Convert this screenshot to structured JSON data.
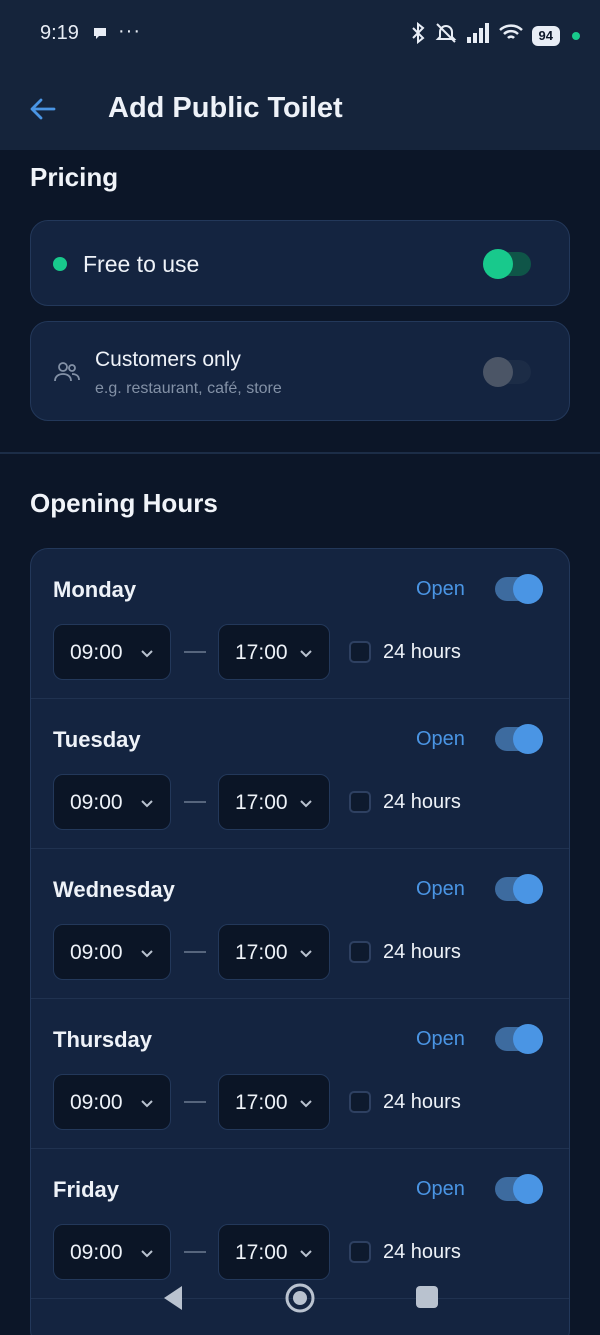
{
  "status_bar": {
    "time": "9:19",
    "dots": "···",
    "battery": "94"
  },
  "app_bar": {
    "title": "Add Public Toilet",
    "back_icon": "arrow-left-icon"
  },
  "pricing": {
    "title": "Pricing",
    "free": {
      "label": "Free to use",
      "enabled": true
    },
    "customers": {
      "label": "Customers only",
      "hint": "e.g. restaurant, café, store",
      "enabled": false,
      "icon": "people-icon"
    }
  },
  "opening_hours": {
    "title": "Opening Hours",
    "days": [
      {
        "name": "Monday",
        "status": "Open",
        "start": "09:00",
        "end": "17:00",
        "all_day_label": "24 hours"
      },
      {
        "name": "Tuesday",
        "status": "Open",
        "start": "09:00",
        "end": "17:00",
        "all_day_label": "24 hours"
      },
      {
        "name": "Wednesday",
        "status": "Open",
        "start": "09:00",
        "end": "17:00",
        "all_day_label": "24 hours"
      },
      {
        "name": "Thursday",
        "status": "Open",
        "start": "09:00",
        "end": "17:00",
        "all_day_label": "24 hours"
      },
      {
        "name": "Friday",
        "status": "Open",
        "start": "09:00",
        "end": "17:00",
        "all_day_label": "24 hours"
      }
    ]
  },
  "colors": {
    "background": "#0c1628",
    "card": "#142440",
    "accent_blue": "#4a95e4",
    "accent_green": "#18c98c"
  }
}
